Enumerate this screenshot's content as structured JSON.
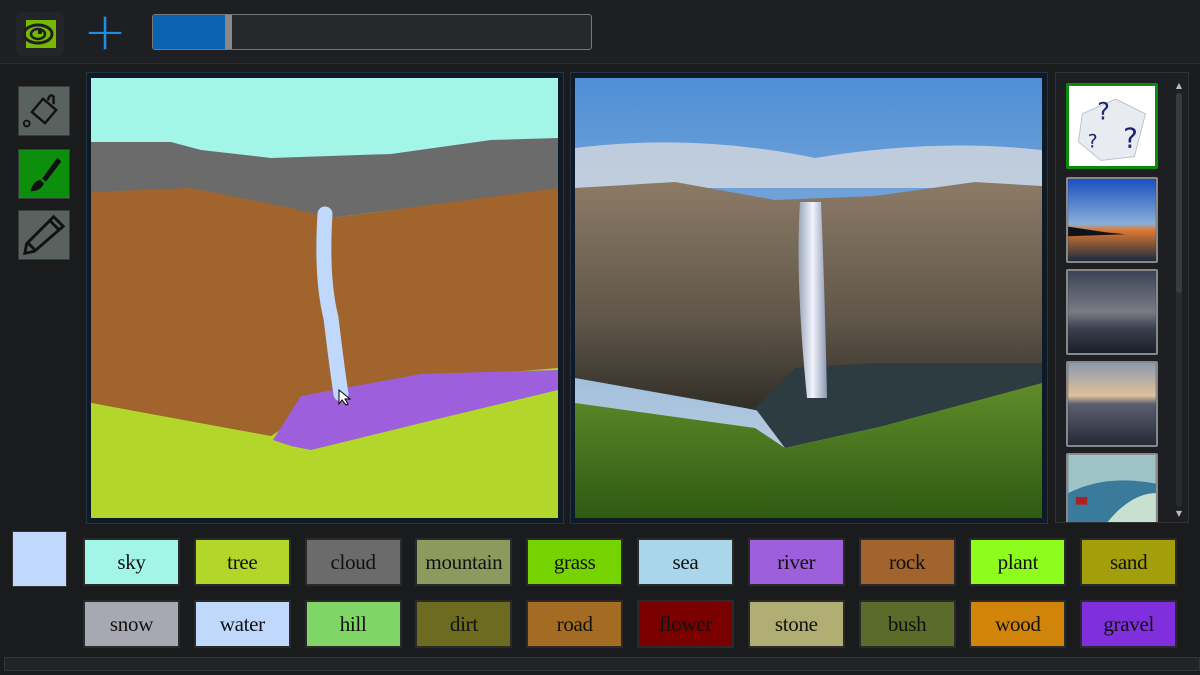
{
  "toolbar": {
    "logo": "nvidia-logo",
    "add_icon": "plus-icon",
    "progress_percent": 18,
    "tools": [
      {
        "name": "paint-bucket-icon",
        "active": false
      },
      {
        "name": "brush-icon",
        "active": true
      },
      {
        "name": "pencil-icon",
        "active": false
      }
    ]
  },
  "palette": {
    "current_color": "#c0d8fb",
    "labels": [
      {
        "label": "sky",
        "color": "#a3f5e8"
      },
      {
        "label": "tree",
        "color": "#b2d629"
      },
      {
        "label": "cloud",
        "color": "#6b6b6b"
      },
      {
        "label": "mountain",
        "color": "#8c9a5e"
      },
      {
        "label": "grass",
        "color": "#75d400"
      },
      {
        "label": "sea",
        "color": "#a9d6ea"
      },
      {
        "label": "river",
        "color": "#9d5fdc"
      },
      {
        "label": "rock",
        "color": "#a0642c"
      },
      {
        "label": "plant",
        "color": "#8efc1c"
      },
      {
        "label": "sand",
        "color": "#a29e0c"
      },
      {
        "label": "snow",
        "color": "#a8a8b3"
      },
      {
        "label": "water",
        "color": "#c0d8fb"
      },
      {
        "label": "hill",
        "color": "#7fd666"
      },
      {
        "label": "dirt",
        "color": "#6c6b1f"
      },
      {
        "label": "road",
        "color": "#a36c22"
      },
      {
        "label": "flower",
        "color": "#7a0000"
      },
      {
        "label": "stone",
        "color": "#b0ae72"
      },
      {
        "label": "bush",
        "color": "#5b6b29"
      },
      {
        "label": "wood",
        "color": "#d1840a"
      },
      {
        "label": "gravel",
        "color": "#7f30dc"
      }
    ]
  },
  "styles": {
    "items": [
      "random-dice-icon",
      "sunset-sea",
      "cloudy-sea",
      "sunset-city",
      "painting-landscape"
    ],
    "selected": 0
  }
}
